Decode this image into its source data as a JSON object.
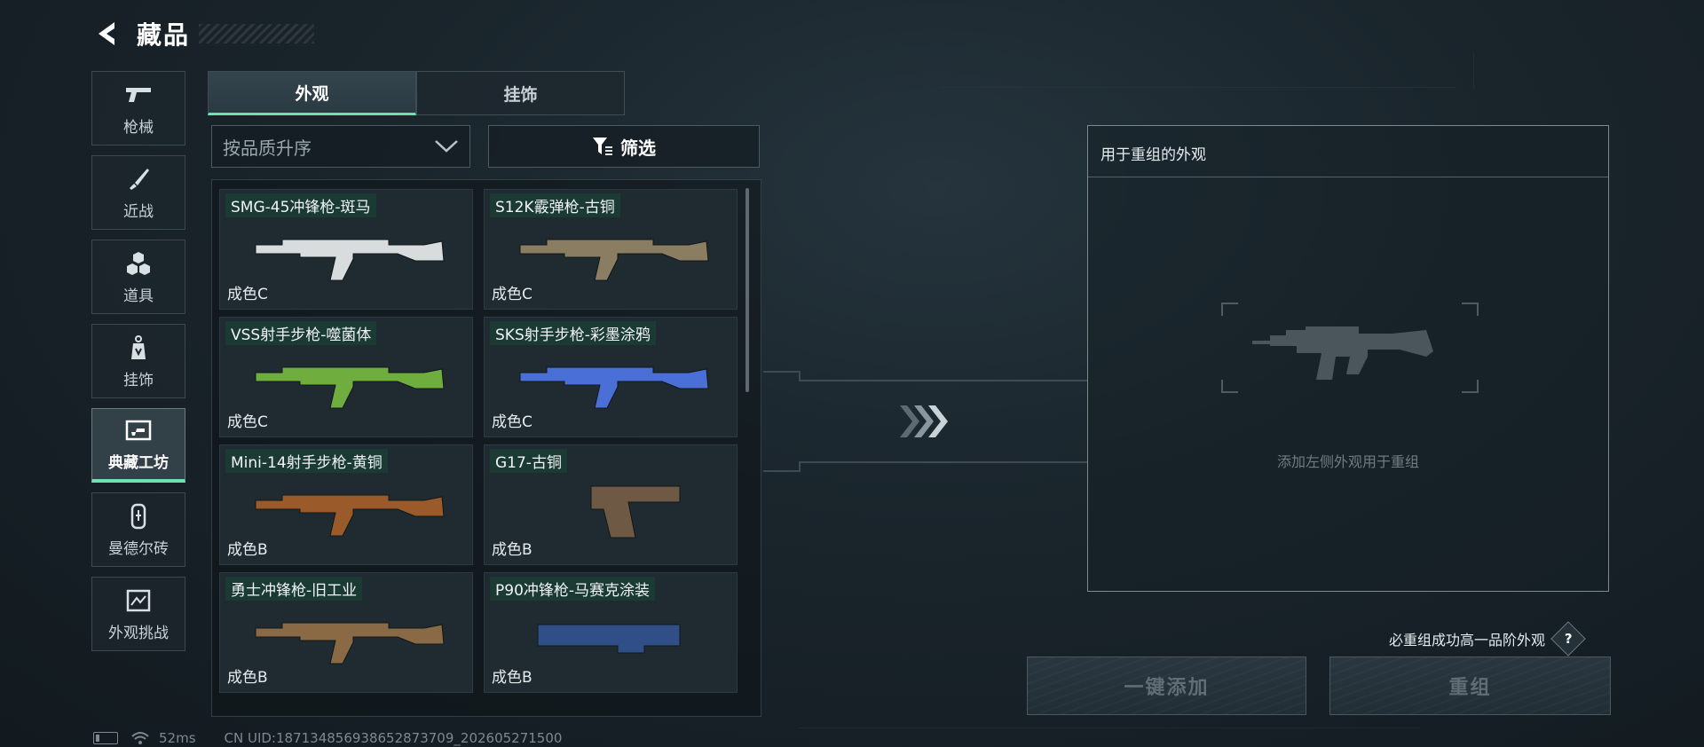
{
  "header": {
    "title": "藏品"
  },
  "sidenav": [
    {
      "label": "枪械",
      "icon": "pistol-icon",
      "active": false
    },
    {
      "label": "近战",
      "icon": "knife-icon",
      "active": false
    },
    {
      "label": "道具",
      "icon": "cubes-icon",
      "active": false
    },
    {
      "label": "挂饰",
      "icon": "charm-icon",
      "active": false
    },
    {
      "label": "典藏工坊",
      "icon": "workshop-icon",
      "active": true
    },
    {
      "label": "曼德尔砖",
      "icon": "brick-icon",
      "active": false
    },
    {
      "label": "外观挑战",
      "icon": "challenge-icon",
      "active": false
    }
  ],
  "tabs": [
    {
      "label": "外观",
      "active": true
    },
    {
      "label": "挂饰",
      "active": false
    }
  ],
  "sort": {
    "label": "按品质升序"
  },
  "filter": {
    "label": "筛选"
  },
  "items": [
    {
      "name": "SMG-45冲锋枪-斑马",
      "grade": "成色C",
      "color": "#d9dcdc"
    },
    {
      "name": "S12K霰弹枪-古铜",
      "grade": "成色C",
      "color": "#8a7d62"
    },
    {
      "name": "VSS射手步枪-噬菌体",
      "grade": "成色C",
      "color": "#6fae3e"
    },
    {
      "name": "SKS射手步枪-彩墨涂鸦",
      "grade": "成色C",
      "color": "#4a6fd6"
    },
    {
      "name": "Mini-14射手步枪-黄铜",
      "grade": "成色B",
      "color": "#9a5a2a"
    },
    {
      "name": "G17-古铜",
      "grade": "成色B",
      "color": "#6e5a44"
    },
    {
      "name": "勇士冲锋枪-旧工业",
      "grade": "成色B",
      "color": "#8a6a45"
    },
    {
      "name": "P90冲锋枪-马赛克涂装",
      "grade": "成色B",
      "color": "#2f4f86"
    }
  ],
  "recomb": {
    "title": "用于重组的外观",
    "hint": "添加左侧外观用于重组"
  },
  "guarantee": {
    "text": "必重组成功高一品阶外观",
    "help": "?"
  },
  "buttons": {
    "one_click_add": "一键添加",
    "recombine": "重组"
  },
  "status": {
    "ping": "52ms",
    "uid": "CN UID:18713485693865287​3709_202605271500"
  },
  "colors": {
    "accent": "#6fe0b0",
    "tag_bg": "#1b3a34"
  }
}
